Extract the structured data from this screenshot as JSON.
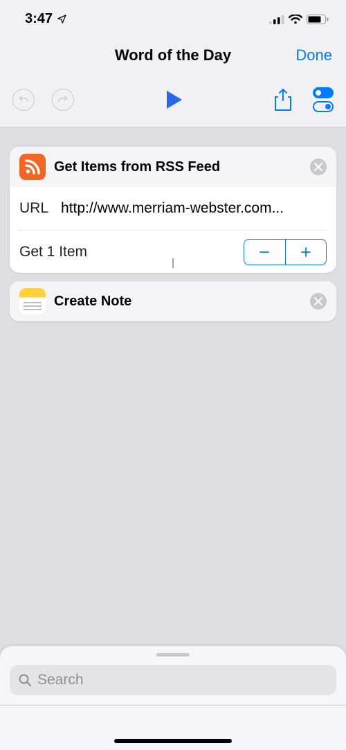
{
  "status": {
    "time": "3:47"
  },
  "nav": {
    "title": "Word of the Day",
    "done": "Done"
  },
  "actions": {
    "rss": {
      "title": "Get Items from RSS Feed",
      "url_label": "URL",
      "url_value": "http://www.merriam-webster.com...",
      "count_label": "Get 1 Item"
    },
    "createNote": {
      "title": "Create Note"
    }
  },
  "search": {
    "placeholder": "Search"
  }
}
